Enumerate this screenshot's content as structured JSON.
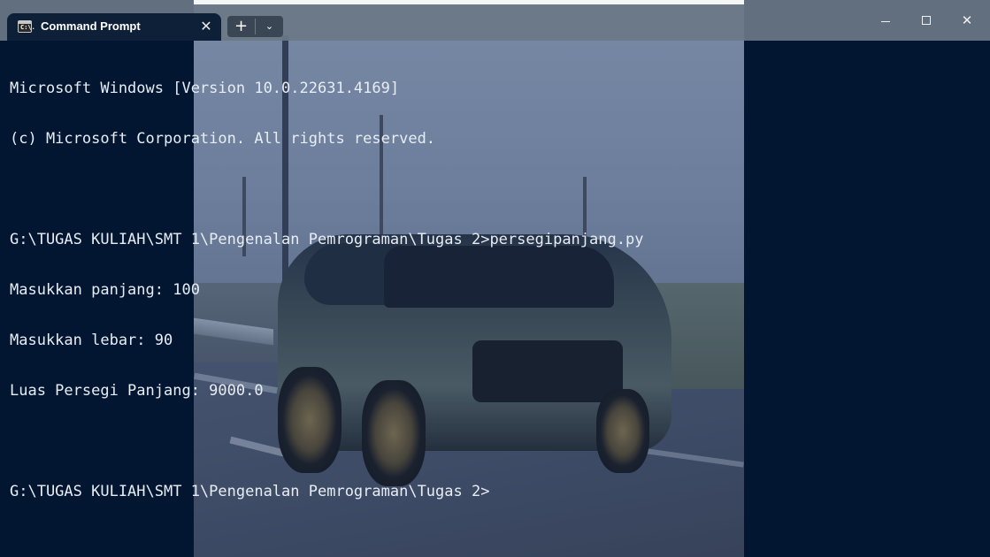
{
  "tab": {
    "title": "Command Prompt",
    "icon": "cmd-icon",
    "icon_glyph": "C:\\."
  },
  "controls": {
    "new_tab": "+",
    "dropdown": "⌄",
    "close_tab": "✕",
    "minimize": "minimize-icon",
    "maximize": "maximize-icon",
    "close": "✕"
  },
  "terminal": {
    "lines": [
      "Microsoft Windows [Version 10.0.22631.4169]",
      "(c) Microsoft Corporation. All rights reserved.",
      "",
      "G:\\TUGAS KULIAH\\SMT 1\\Pengenalan Pemrograman\\Tugas 2>persegipanjang.py",
      "Masukkan panjang: 100",
      "Masukkan lebar: 90",
      "Luas Persegi Panjang: 9000.0",
      "",
      "G:\\TUGAS KULIAH\\SMT 1\\Pengenalan Pemrograman\\Tugas 2>"
    ]
  },
  "colors": {
    "background": "#021632",
    "text": "#e8edf4",
    "titlebar": "#6a7785"
  }
}
